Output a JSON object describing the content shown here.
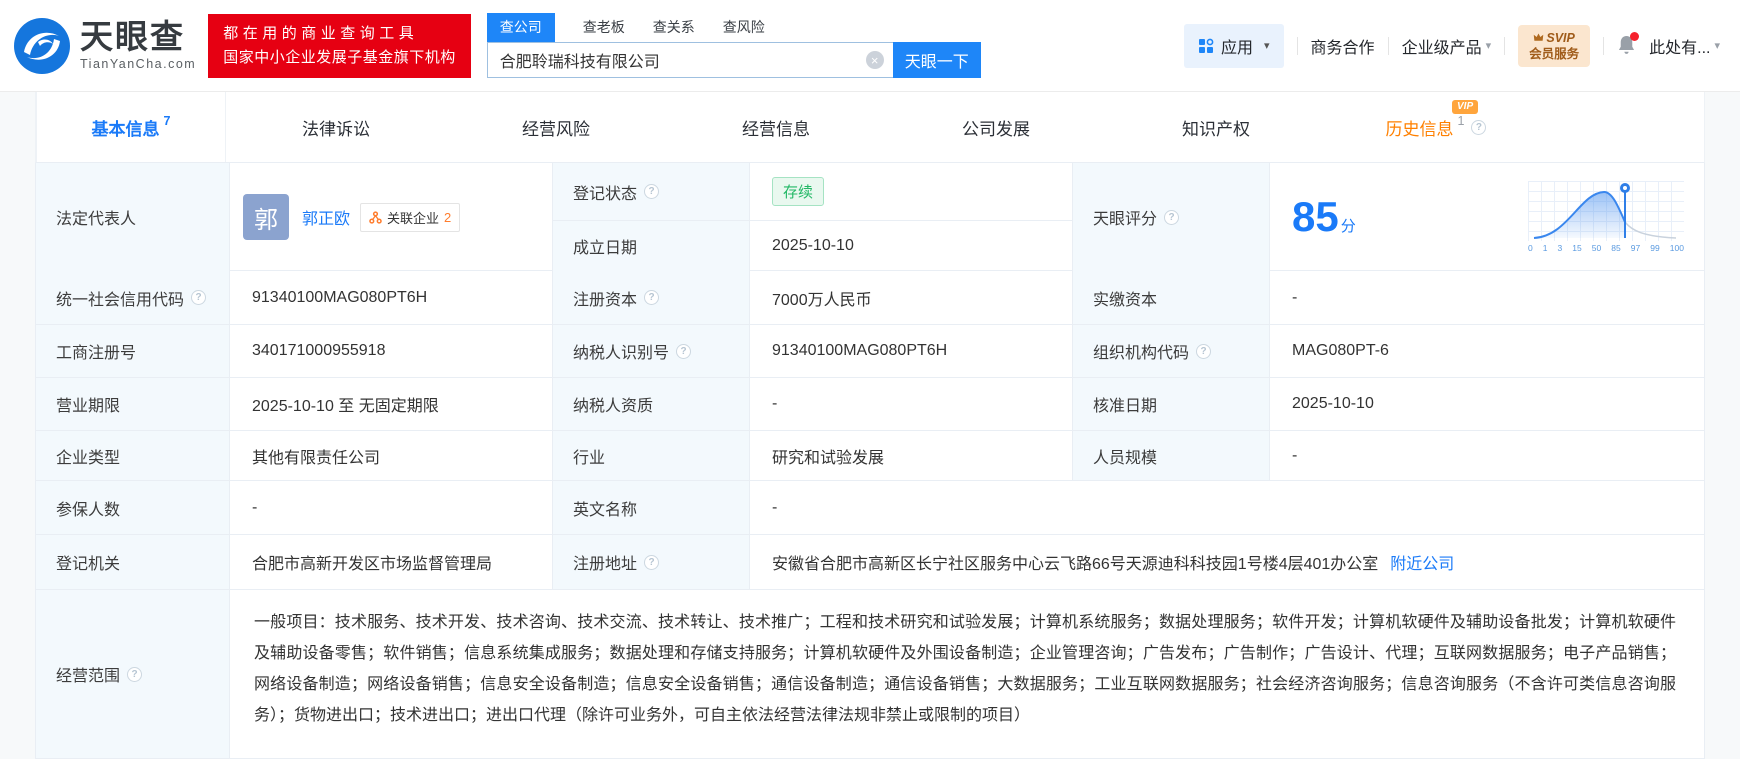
{
  "header": {
    "logo": {
      "title": "天眼查",
      "domain": "TianYanCha.com"
    },
    "slogan": {
      "line1": "都在用的商业查询工具",
      "line2": "国家中小企业发展子基金旗下机构"
    },
    "search": {
      "tabs": [
        {
          "label": "查公司"
        },
        {
          "label": "查老板"
        },
        {
          "label": "查关系"
        },
        {
          "label": "查风险"
        }
      ],
      "value": "合肥聆瑞科技有限公司",
      "button": "天眼一下"
    },
    "menu": {
      "apps": "应用",
      "biz": "商务合作",
      "enterprise": "企业级产品",
      "vip_top": "SVIP",
      "vip_bottom": "会员服务",
      "user": "此处有..."
    }
  },
  "nav": {
    "tabs": [
      {
        "label": "基本信息",
        "count": "7"
      },
      {
        "label": "法律诉讼"
      },
      {
        "label": "经营风险"
      },
      {
        "label": "经营信息"
      },
      {
        "label": "公司发展"
      },
      {
        "label": "知识产权"
      },
      {
        "label": "历史信息",
        "count": "1",
        "tag": "VIP"
      }
    ]
  },
  "table": {
    "legal_rep": {
      "label": "法定代表人",
      "avatar": "郭",
      "name": "郭正欧",
      "badge": "关联企业",
      "badge_count": "2"
    },
    "reg_status": {
      "label": "登记状态",
      "value": "存续"
    },
    "est_date": {
      "label": "成立日期",
      "value": "2025-10-10"
    },
    "score": {
      "label": "天眼评分",
      "value": "85",
      "unit": "分",
      "axis": [
        "0",
        "1",
        "3",
        "15",
        "50",
        "85",
        "97",
        "99",
        "100"
      ]
    },
    "credit_code": {
      "label": "统一社会信用代码",
      "value": "91340100MAG080PT6H"
    },
    "reg_capital": {
      "label": "注册资本",
      "value": "7000万人民币"
    },
    "paid_capital": {
      "label": "实缴资本",
      "value": "-"
    },
    "reg_number": {
      "label": "工商注册号",
      "value": "340171000955918"
    },
    "taxpayer_id": {
      "label": "纳税人识别号",
      "value": "91340100MAG080PT6H"
    },
    "org_code": {
      "label": "组织机构代码",
      "value": "MAG080PT-6"
    },
    "biz_term": {
      "label": "营业期限",
      "value": "2025-10-10 至 无固定期限"
    },
    "taxpayer_quality": {
      "label": "纳税人资质",
      "value": "-"
    },
    "approval_date": {
      "label": "核准日期",
      "value": "2025-10-10"
    },
    "company_type": {
      "label": "企业类型",
      "value": "其他有限责任公司"
    },
    "industry": {
      "label": "行业",
      "value": "研究和试验发展"
    },
    "staff_size": {
      "label": "人员规模",
      "value": "-"
    },
    "insured_count": {
      "label": "参保人数",
      "value": "-"
    },
    "english_name": {
      "label": "英文名称",
      "value": "-"
    },
    "reg_authority": {
      "label": "登记机关",
      "value": "合肥市高新开发区市场监督管理局"
    },
    "reg_address": {
      "label": "注册地址",
      "value": "安徽省合肥市高新区长宁社区服务中心云飞路66号天源迪科科技园1号楼4层401办公室",
      "link": "附近公司"
    },
    "biz_scope": {
      "label": "经营范围",
      "value": "一般项目：技术服务、技术开发、技术咨询、技术交流、技术转让、技术推广；工程和技术研究和试验发展；计算机系统服务；数据处理服务；软件开发；计算机软硬件及辅助设备批发；计算机软硬件及辅助设备零售；软件销售；信息系统集成服务；数据处理和存储支持服务；计算机软硬件及外围设备制造；企业管理咨询；广告发布；广告制作；广告设计、代理；互联网数据服务；电子产品销售；网络设备制造；网络设备销售；信息安全设备制造；信息安全设备销售；通信设备制造；通信设备销售；大数据服务；工业互联网数据服务；社会经济咨询服务；信息咨询服务（不含许可类信息咨询服务）；货物进出口；技术进出口；进出口代理（除许可业务外，可自主依法经营法律法规非禁止或限制的项目）"
    }
  },
  "colors": {
    "brand_blue": "#1a7af8",
    "red": "#e60012",
    "green": "#23b866",
    "orange": "#ff8000"
  }
}
